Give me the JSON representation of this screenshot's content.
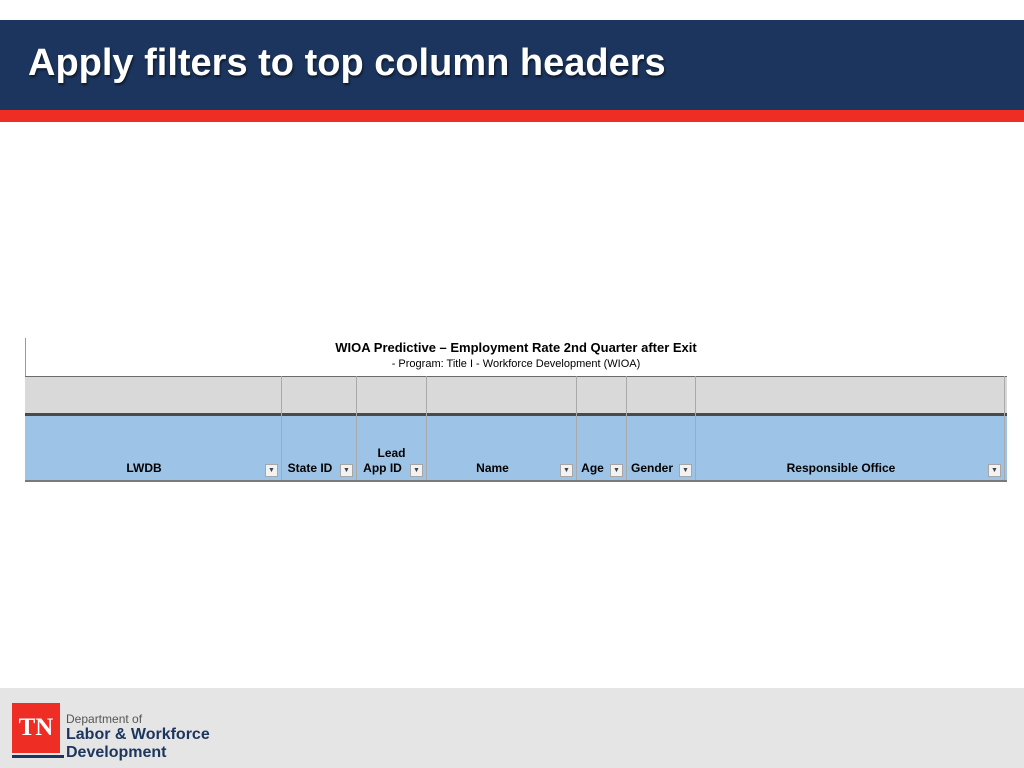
{
  "slide": {
    "title": "Apply filters to top column headers"
  },
  "report": {
    "title": "WIOA Predictive – Employment Rate 2nd Quarter after Exit",
    "subtitle": "- Program: Title I - Workforce Development (WIOA)"
  },
  "columns": [
    {
      "label": "LWDB",
      "lead": ""
    },
    {
      "label": "State ID",
      "lead": ""
    },
    {
      "label": "App ID",
      "lead": "Lead"
    },
    {
      "label": "Name",
      "lead": ""
    },
    {
      "label": "Age",
      "lead": ""
    },
    {
      "label": "Gender",
      "lead": ""
    },
    {
      "label": "Responsible Office",
      "lead": ""
    }
  ],
  "footer": {
    "logo_text": "TN",
    "dept_line1": "Department of",
    "dept_line2": "Labor & Workforce",
    "dept_line3": "Development"
  },
  "icons": {
    "filter": "dropdown-arrow-icon"
  },
  "colors": {
    "title_bar": "#1c355e",
    "accent_stripe": "#ee2d24",
    "header_row": "#9dc3e6",
    "gray_row": "#d9d9d9"
  }
}
